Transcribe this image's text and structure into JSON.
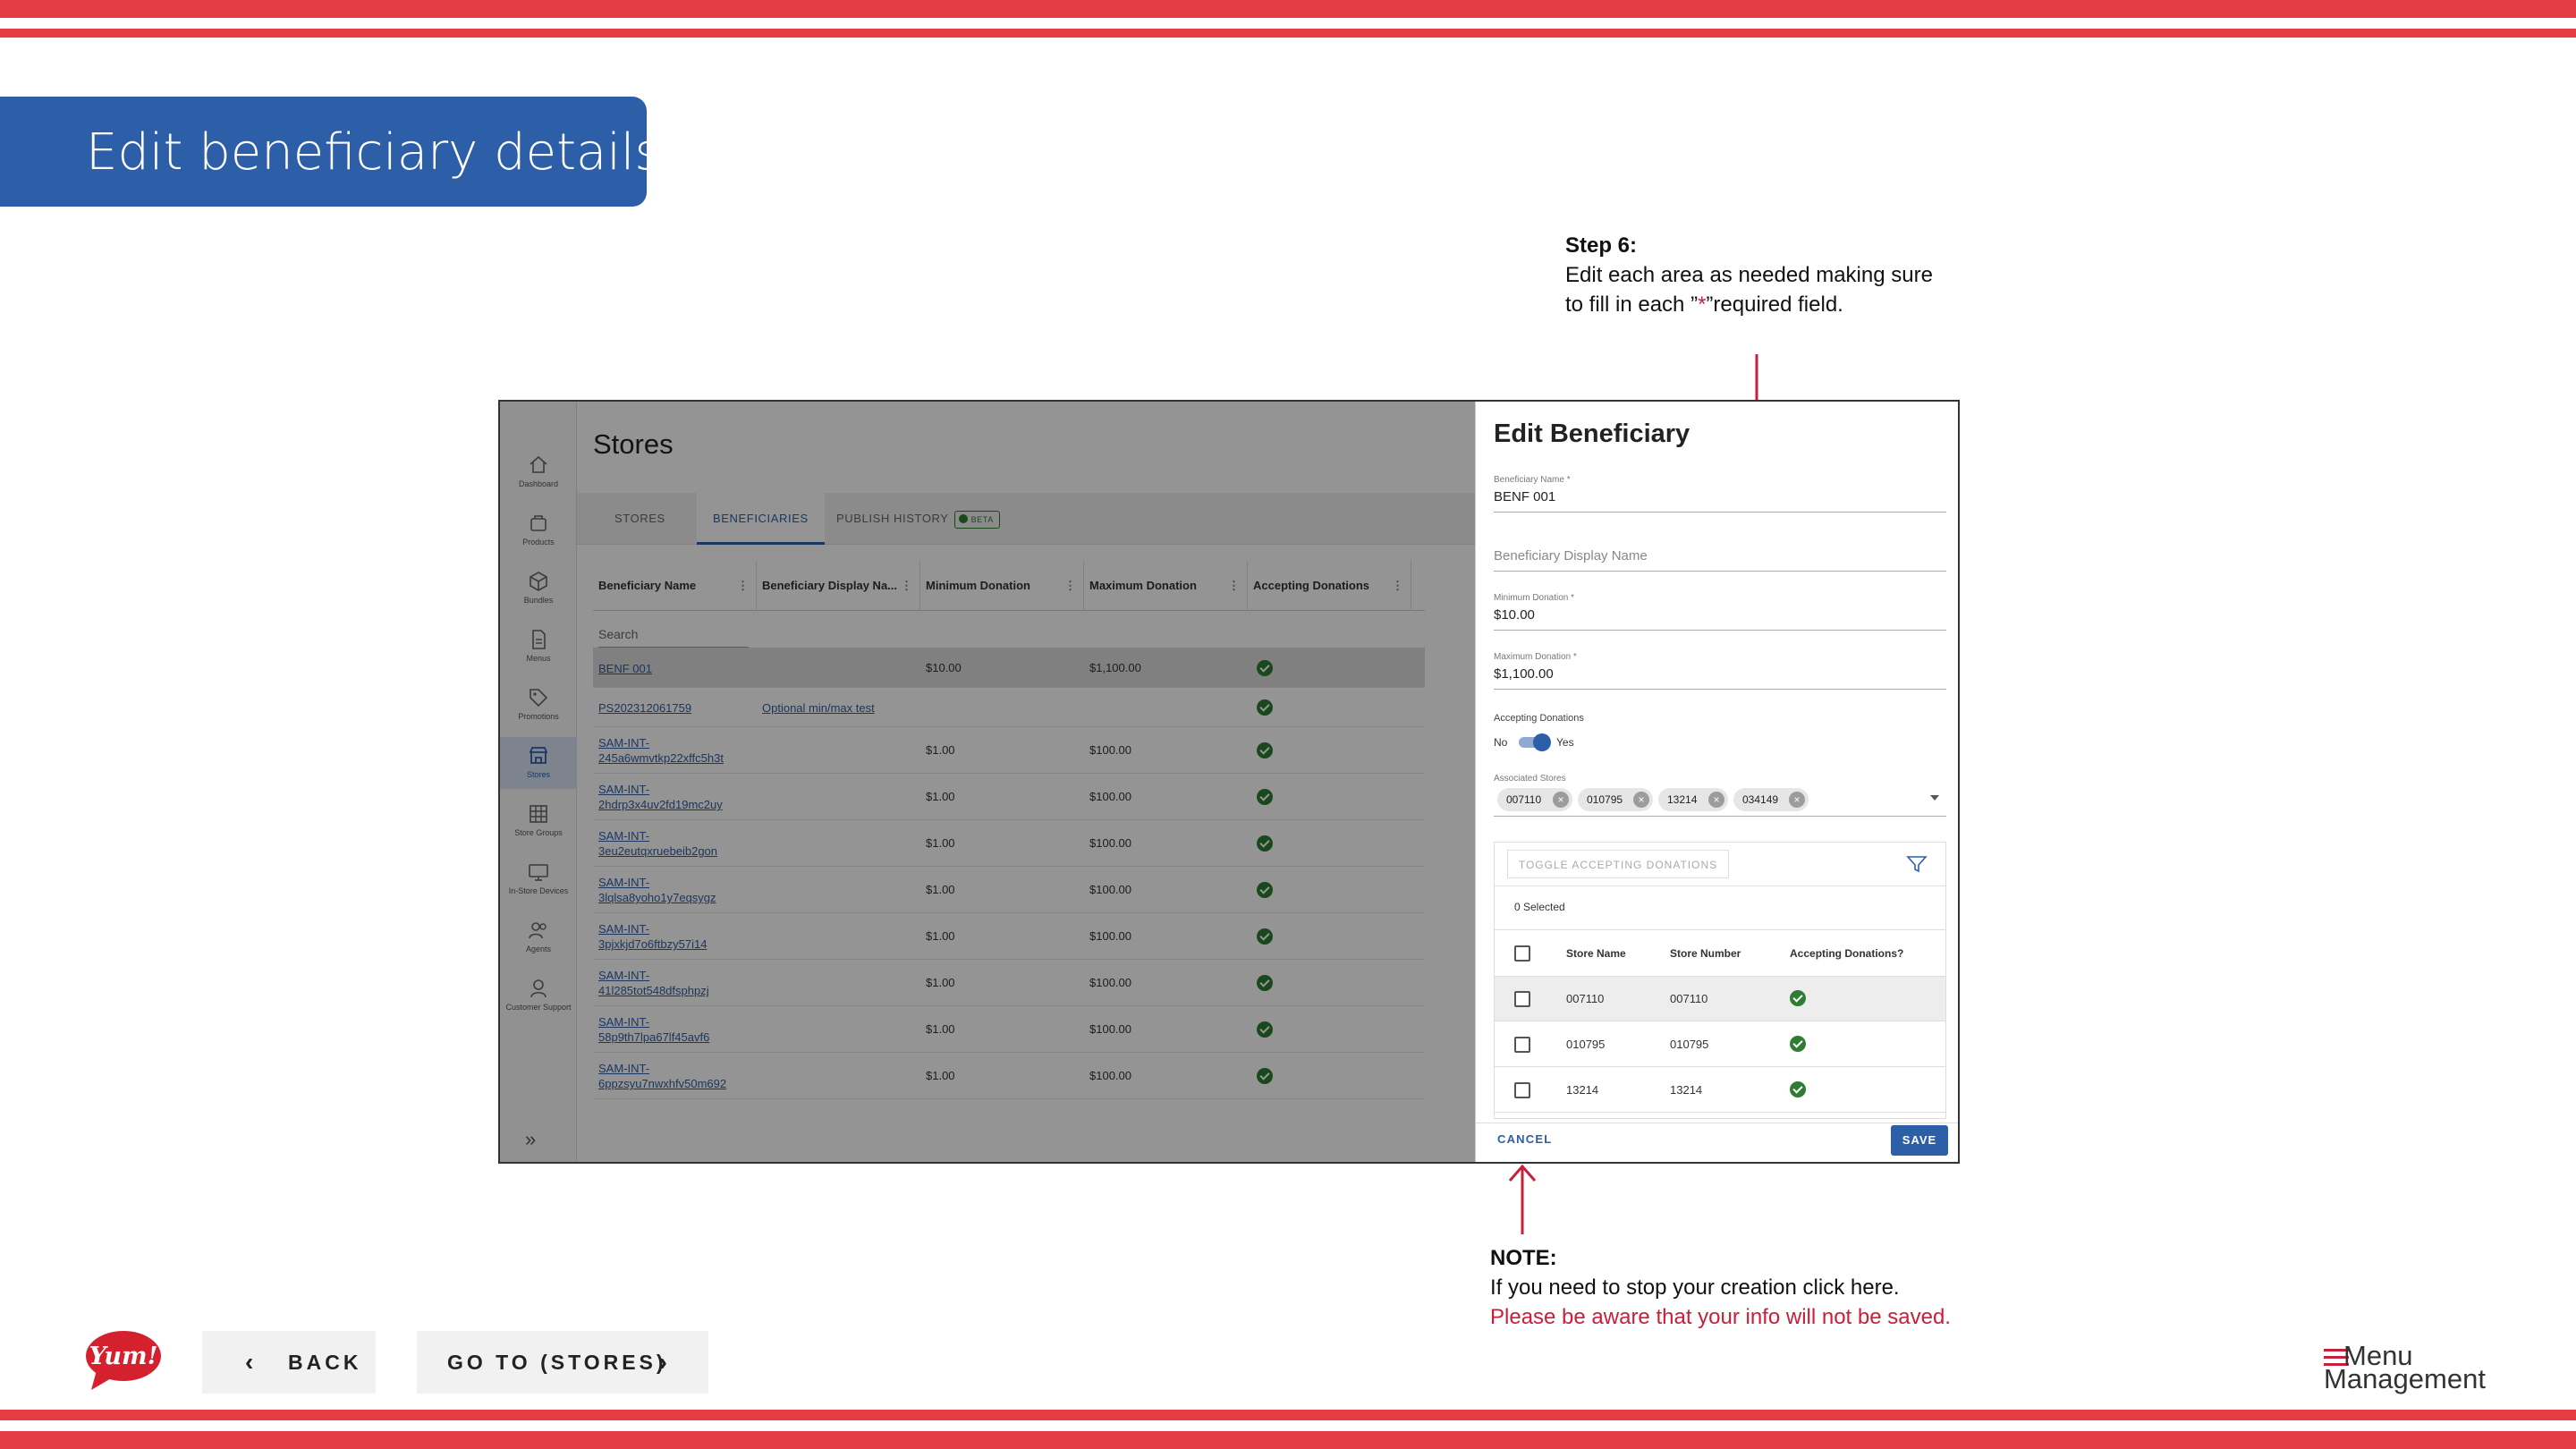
{
  "slide": {
    "title": "Edit beneficiary details",
    "step": {
      "heading": "Step 6:",
      "line1": "Edit each area as needed making sure",
      "line2_pre": "to fill in each ”",
      "line2_star": "*",
      "line2_post": "”required field."
    },
    "note": {
      "heading": "NOTE:",
      "line1": "If you need to stop your creation click here.",
      "line2": "Please be aware that your info will not be saved."
    },
    "accent_red": "#e43c43",
    "accent_blue": "#2d5ea8"
  },
  "app": {
    "nav": [
      {
        "label": "Dashboard",
        "icon": "home-icon"
      },
      {
        "label": "Products",
        "icon": "product-box-icon"
      },
      {
        "label": "Bundles",
        "icon": "cube-icon"
      },
      {
        "label": "Menus",
        "icon": "document-icon"
      },
      {
        "label": "Promotions",
        "icon": "tag-icon"
      },
      {
        "label": "Stores",
        "icon": "store-icon",
        "active": true
      },
      {
        "label": "Store Groups",
        "icon": "grid-icon"
      },
      {
        "label": "In-Store Devices",
        "icon": "monitor-icon"
      },
      {
        "label": "Agents",
        "icon": "people-icon"
      },
      {
        "label": "Customer Support",
        "icon": "support-person-icon"
      }
    ],
    "expand_icon": "»",
    "page_title": "Stores",
    "tabs": [
      "STORES",
      "BENEFICIARIES",
      "PUBLISH HISTORY"
    ],
    "beta_label": "BETA",
    "columns": [
      "Beneficiary Name",
      "Beneficiary Display Na...",
      "Minimum Donation",
      "Maximum Donation",
      "Accepting Donations"
    ],
    "search_placeholder": "Search",
    "rows": [
      {
        "name": "BENF 001",
        "display": "",
        "min": "$10.00",
        "max": "$1,100.00",
        "accepting": true
      },
      {
        "name": "PS202312061759",
        "display": "Optional min/max test",
        "min": "",
        "max": "",
        "accepting": true
      },
      {
        "name": "SAM-INT-245a6wmvtkp22xffc5h3t",
        "display": "",
        "min": "$1.00",
        "max": "$100.00",
        "accepting": true
      },
      {
        "name": "SAM-INT-2hdrp3x4uv2fd19mc2uy",
        "display": "",
        "min": "$1.00",
        "max": "$100.00",
        "accepting": true
      },
      {
        "name": "SAM-INT-3eu2eutqxruebeib2gon",
        "display": "",
        "min": "$1.00",
        "max": "$100.00",
        "accepting": true
      },
      {
        "name": "SAM-INT-3lqlsa8yoho1y7eqsygz",
        "display": "",
        "min": "$1.00",
        "max": "$100.00",
        "accepting": true
      },
      {
        "name": "SAM-INT-3pjxkjd7o6ftbzy57i14",
        "display": "",
        "min": "$1.00",
        "max": "$100.00",
        "accepting": true
      },
      {
        "name": "SAM-INT-41l285tot548dfsphpzj",
        "display": "",
        "min": "$1.00",
        "max": "$100.00",
        "accepting": true
      },
      {
        "name": "SAM-INT-58p9th7lpa67lf45avf6",
        "display": "",
        "min": "$1.00",
        "max": "$100.00",
        "accepting": true
      },
      {
        "name": "SAM-INT-6ppzsyu7nwxhfv50m692",
        "display": "",
        "min": "$1.00",
        "max": "$100.00",
        "accepting": true
      }
    ]
  },
  "drawer": {
    "title": "Edit Beneficiary",
    "name_label": "Beneficiary Name *",
    "name_value": "BENF 001",
    "display_placeholder": "Beneficiary Display Name",
    "min_label": "Minimum Donation *",
    "min_value": "$10.00",
    "max_label": "Maximum Donation *",
    "max_value": "$1,100.00",
    "accepting_label": "Accepting Donations",
    "toggle_off": "No",
    "toggle_on": "Yes",
    "toggle_state": true,
    "stores_label": "Associated Stores",
    "chips": [
      "007110",
      "010795",
      "13214",
      "034149"
    ],
    "toggle_button": "TOGGLE ACCEPTING DONATIONS",
    "selected_count": "0 Selected",
    "store_columns": [
      "Store Name",
      "Store Number",
      "Accepting Donations?"
    ],
    "stores": [
      {
        "name": "007110",
        "number": "007110",
        "accepting": true
      },
      {
        "name": "010795",
        "number": "010795",
        "accepting": true
      },
      {
        "name": "13214",
        "number": "13214",
        "accepting": true
      }
    ],
    "cancel": "CANCEL",
    "save": "SAVE"
  },
  "footer": {
    "back": "BACK",
    "go": "GO TO (STORES)",
    "yum_logo": "Yum!",
    "mm_logo_line1": "Menu",
    "mm_logo_line2": "Management"
  }
}
